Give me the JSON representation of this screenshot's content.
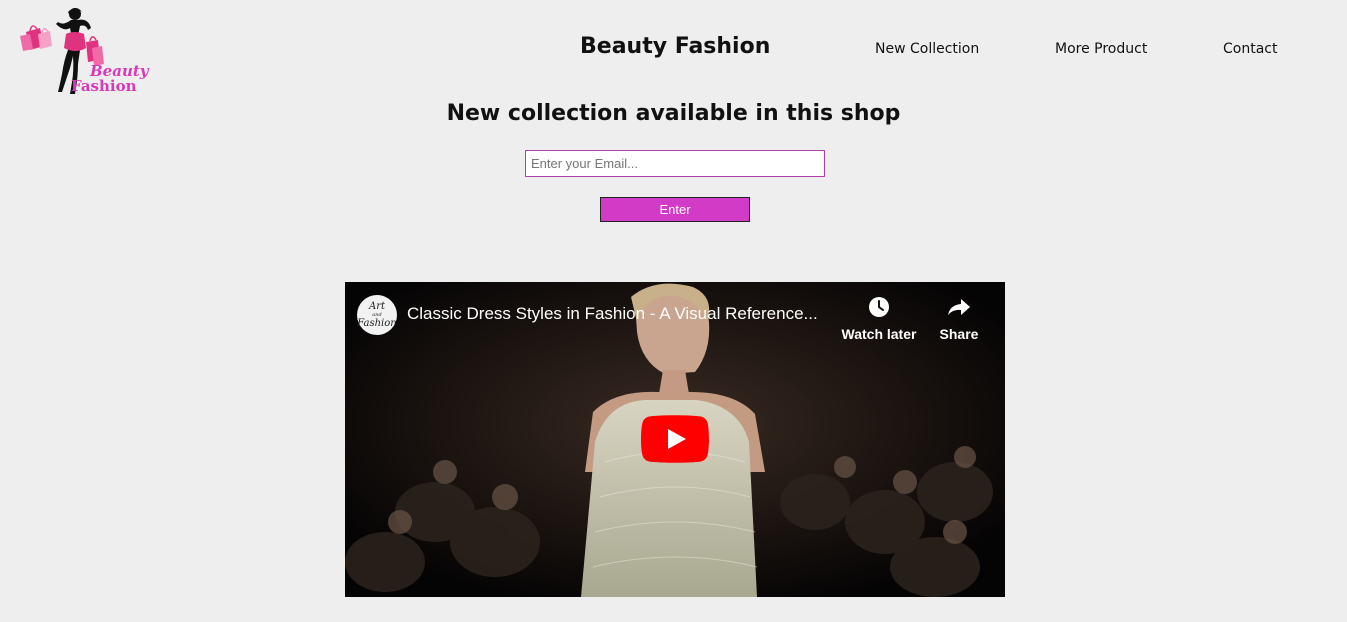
{
  "logo": {
    "line1": "Beauty",
    "line2": "Fashion",
    "icon": "woman-shopping-bags-icon",
    "accent_color": "#d63ab8"
  },
  "header": {
    "brand": "Beauty Fashion",
    "nav": [
      {
        "label": "New Collection"
      },
      {
        "label": "More Product"
      },
      {
        "label": "Contact"
      }
    ]
  },
  "main": {
    "headline": "New collection available in this shop",
    "email_placeholder": "Enter your Email...",
    "email_value": "",
    "enter_label": "Enter",
    "button_color": "#d23bc6"
  },
  "video": {
    "channel_avatar_line1": "Art",
    "channel_avatar_line2": "and",
    "channel_avatar_line3": "Fashion",
    "title": "Classic Dress Styles in Fashion - A Visual Reference...",
    "watch_later_label": "Watch later",
    "share_label": "Share",
    "watch_later_icon": "clock-icon",
    "share_icon": "share-arrow-icon",
    "play_icon": "youtube-play-icon",
    "play_color": "#ff0000"
  }
}
